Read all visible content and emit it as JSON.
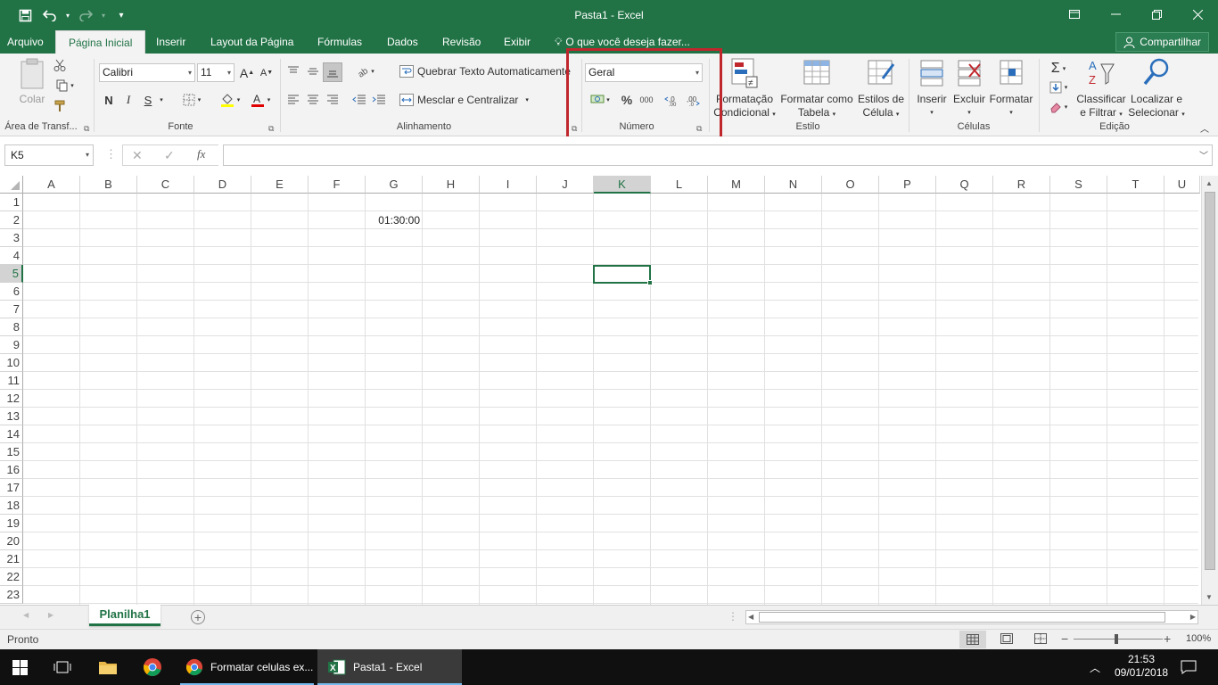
{
  "window": {
    "title": "Pasta1 - Excel",
    "colors": {
      "accent": "#217346",
      "highlight": "#c0272d"
    }
  },
  "qat": {
    "save": "save-icon",
    "undo": "undo-icon",
    "redo": "redo-icon",
    "customize": "customize-icon"
  },
  "tabs": [
    "Arquivo",
    "Página Inicial",
    "Inserir",
    "Layout da Página",
    "Fórmulas",
    "Dados",
    "Revisão",
    "Exibir"
  ],
  "tell_me": "O que você deseja fazer...",
  "share_label": "Compartilhar",
  "ribbon": {
    "clipboard": {
      "label": "Área de Transf...",
      "paste": "Colar"
    },
    "font": {
      "label": "Fonte",
      "name": "Calibri",
      "size": "11",
      "bold": "N",
      "italic": "I",
      "underline": "S",
      "grow": "A",
      "shrink": "A"
    },
    "alignment": {
      "label": "Alinhamento",
      "wrap": "Quebrar Texto Automaticamente",
      "merge": "Mesclar e Centralizar"
    },
    "number": {
      "label": "Número",
      "format": "Geral",
      "percent": "%",
      "thousands": "000",
      "inc_decimal": "←,0",
      "dec_decimal": ",00"
    },
    "styles": {
      "label": "Estilo",
      "cond_format_1": "Formatação",
      "cond_format_2": "Condicional",
      "format_table_1": "Formatar como",
      "format_table_2": "Tabela",
      "cell_styles_1": "Estilos de",
      "cell_styles_2": "Célula"
    },
    "cells": {
      "label": "Células",
      "insert": "Inserir",
      "delete": "Excluir",
      "format": "Formatar"
    },
    "editing": {
      "label": "Edição",
      "sort_1": "Classificar",
      "sort_2": "e Filtrar",
      "find_1": "Localizar e",
      "find_2": "Selecionar",
      "sum": "Σ"
    }
  },
  "formula_bar": {
    "name_box": "K5",
    "cancel": "✕",
    "confirm": "✓",
    "fx": "fx",
    "value": ""
  },
  "grid": {
    "columns": [
      "A",
      "B",
      "C",
      "D",
      "E",
      "F",
      "G",
      "H",
      "I",
      "J",
      "K",
      "L",
      "M",
      "N",
      "O",
      "P",
      "Q",
      "R",
      "S",
      "T",
      "U"
    ],
    "rows": [
      "1",
      "2",
      "3",
      "4",
      "5",
      "6",
      "7",
      "8",
      "9",
      "10",
      "11",
      "12",
      "13",
      "14",
      "15",
      "16",
      "17",
      "18",
      "19",
      "20",
      "21",
      "22",
      "23"
    ],
    "selected_col": "K",
    "selected_row": "5",
    "cell_g2": "01:30:00"
  },
  "sheet": {
    "name": "Planilha1"
  },
  "status": {
    "ready": "Pronto",
    "zoom": "100%"
  },
  "taskbar": {
    "chrome_window": "Formatar celulas ex...",
    "excel_window": "Pasta1 - Excel",
    "time": "21:53",
    "date": "09/01/2018"
  }
}
